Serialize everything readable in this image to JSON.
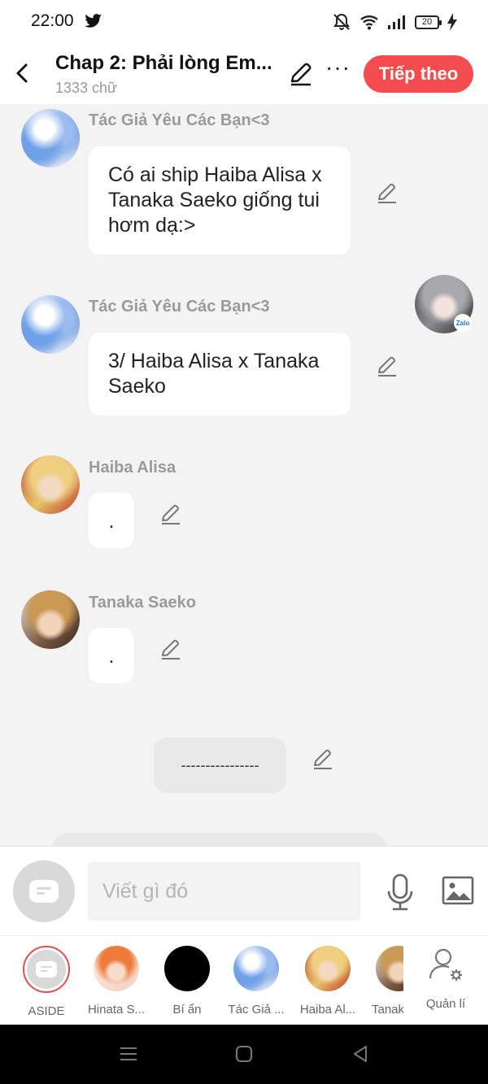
{
  "status_bar": {
    "time": "22:00",
    "battery": "20"
  },
  "header": {
    "title": "Chap 2: Phải lòng Em...",
    "word_count": "1333 chữ",
    "next_button": "Tiếp theo"
  },
  "messages": [
    {
      "sender": "Tác Giả Yêu Các Bạn<3",
      "text": "Có ai ship Haiba Alisa x Tanaka Saeko giống tui hơm dạ:>"
    },
    {
      "sender": "Tác Giả Yêu Các Bạn<3",
      "text": "3/ Haiba Alisa x Tanaka Saeko"
    },
    {
      "sender": "Haiba Alisa",
      "text": "."
    },
    {
      "sender": "Tanaka Saeko",
      "text": "."
    }
  ],
  "floating_avatar_badge": "Zalo",
  "divider_text": "----------------",
  "composer": {
    "placeholder": "Viết gì đó"
  },
  "characters": [
    {
      "label": "ASIDE"
    },
    {
      "label": "Hinata S..."
    },
    {
      "label": "Bí ẩn"
    },
    {
      "label": "Tác Giả ..."
    },
    {
      "label": "Haiba Al..."
    },
    {
      "label": "Tanaka"
    }
  ],
  "manage_label": "Quản lí",
  "colors": {
    "accent": "#f54d4f",
    "background": "#f3f3f4",
    "bubble": "#ffffff"
  }
}
